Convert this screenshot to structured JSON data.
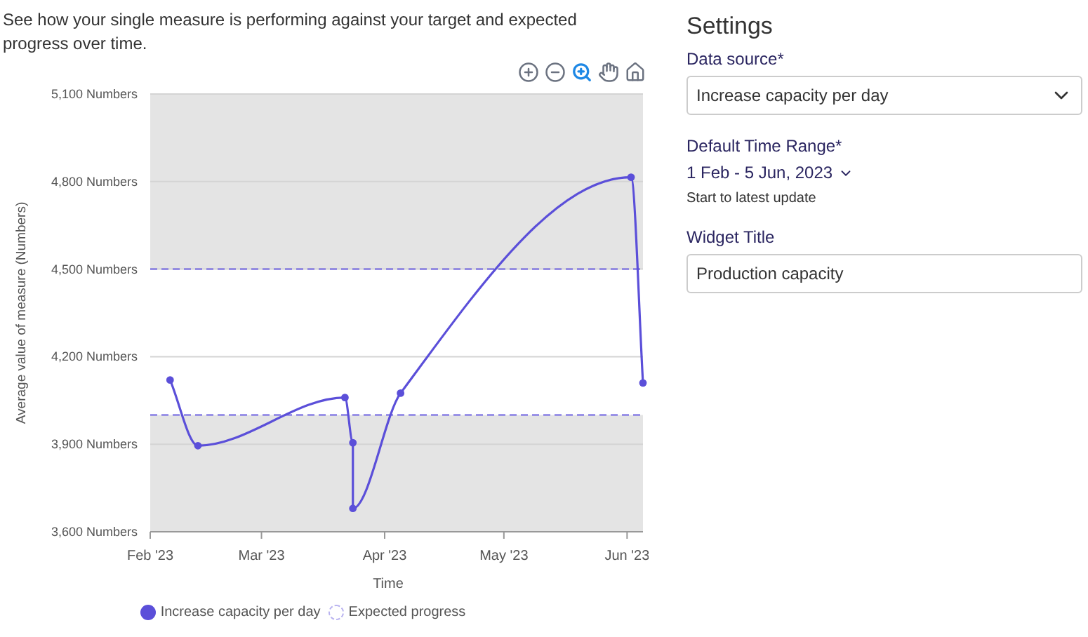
{
  "description": "See how your single measure is performing against your target and expected progress over time.",
  "toolbar": [
    {
      "kind": "zoom_in",
      "selected": false
    },
    {
      "kind": "zoom_out",
      "selected": false
    },
    {
      "kind": "zoom",
      "selected": true
    },
    {
      "kind": "pan",
      "selected": false
    },
    {
      "kind": "home",
      "selected": false
    }
  ],
  "chart_data": {
    "type": "line",
    "xlabel": "Time",
    "ylabel": "Average value of measure (Numbers)",
    "x": [
      "2023-02-06",
      "2023-02-13",
      "2023-03-22",
      "2023-03-24",
      "2023-03-24",
      "2023-04-05",
      "2023-06-02",
      "2023-06-05"
    ],
    "series": [
      {
        "name": "Increase capacity per day",
        "color": "#5b4fd9",
        "marker": "circle",
        "values": [
          4120,
          3895,
          4060,
          3905,
          3680,
          4075,
          4815,
          4110
        ]
      }
    ],
    "xlim": [
      "2023-02-01",
      "2023-06-05"
    ],
    "ylim": [
      3600,
      5100
    ],
    "xticks": [
      {
        "value": "2023-02-01",
        "label": "Feb '23"
      },
      {
        "value": "2023-03-01",
        "label": "Mar '23"
      },
      {
        "value": "2023-04-01",
        "label": "Apr '23"
      },
      {
        "value": "2023-05-01",
        "label": "May '23"
      },
      {
        "value": "2023-06-01",
        "label": "Jun '23"
      }
    ],
    "yticks": [
      {
        "value": 3600,
        "label": "3,600 Numbers"
      },
      {
        "value": 3900,
        "label": "3,900 Numbers"
      },
      {
        "value": 4200,
        "label": "4,200 Numbers"
      },
      {
        "value": 4500,
        "label": "4,500 Numbers"
      },
      {
        "value": 4800,
        "label": "4,800 Numbers"
      },
      {
        "value": 5100,
        "label": "5,100 Numbers"
      }
    ],
    "grid": true,
    "ref_lines": [
      {
        "axis": "y",
        "value": 4500,
        "color": "#6b5fe0"
      },
      {
        "axis": "y",
        "value": 4000,
        "color": "#6b5fe0"
      }
    ],
    "bands": [
      {
        "axis": "y",
        "from": 4000,
        "to": 4500,
        "color": "#ffffff"
      }
    ]
  },
  "legend": [
    {
      "kind": "series"
    },
    {
      "kind": "dashed",
      "label": "Expected progress",
      "color": "#b9b3f0"
    }
  ],
  "settings": {
    "title": "Settings",
    "data_source": {
      "label": "Data source*",
      "value": "Increase capacity per day"
    },
    "time_range": {
      "label": "Default Time Range*",
      "value": "1 Feb - 5 Jun, 2023",
      "hint": "Start to latest update"
    },
    "widget_title": {
      "label": "Widget Title",
      "value": "Production capacity"
    }
  }
}
